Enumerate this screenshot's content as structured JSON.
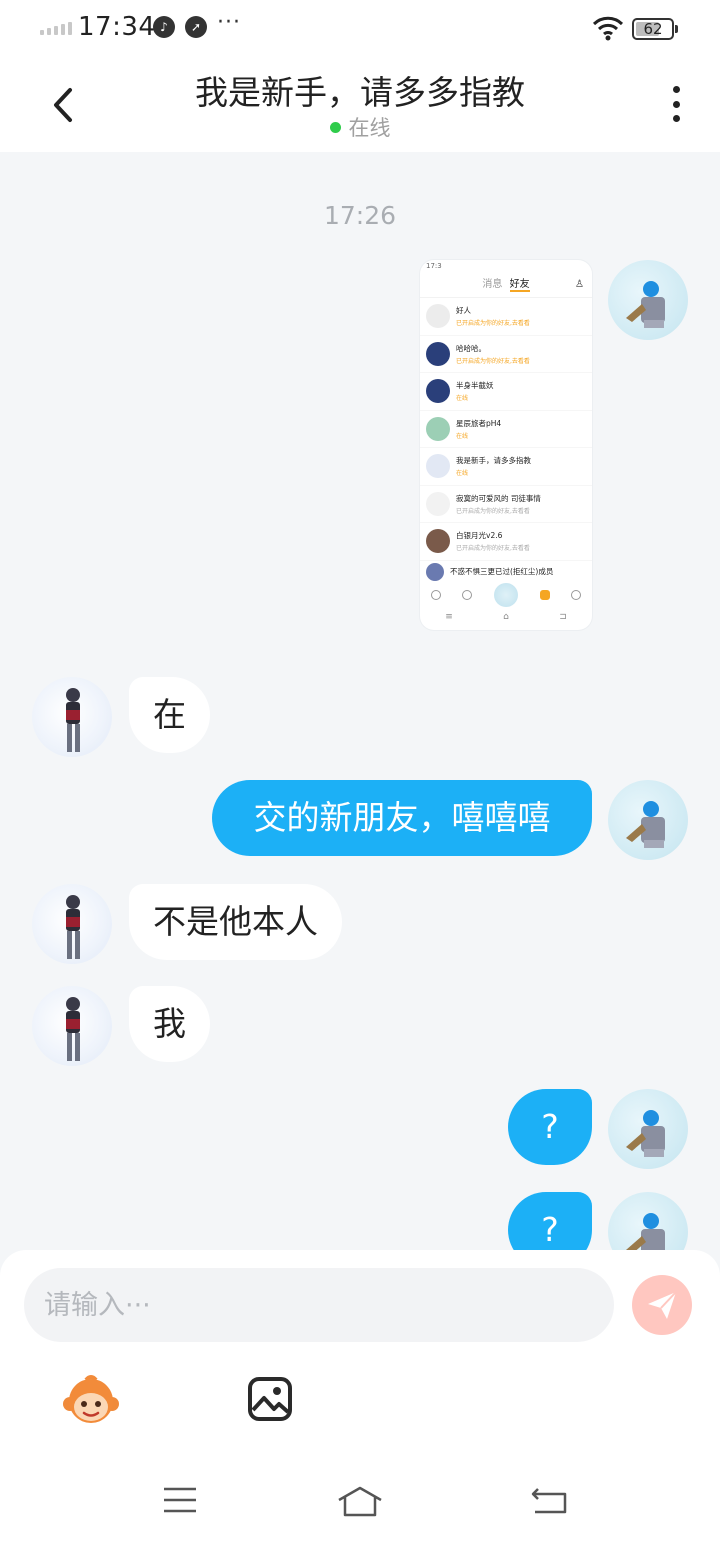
{
  "status_bar": {
    "time": "17:34",
    "more": "···",
    "battery": "62"
  },
  "header": {
    "title": "我是新手，请多多指教",
    "status": "在线"
  },
  "chat": {
    "timestamp": "17:26",
    "messages": [
      {
        "from": "me",
        "type": "image"
      },
      {
        "from": "other",
        "text": "在"
      },
      {
        "from": "me",
        "text": "交的新朋友，嘻嘻嘻"
      },
      {
        "from": "other",
        "text": "不是他本人"
      },
      {
        "from": "other",
        "text": "我"
      },
      {
        "from": "me",
        "text": "?"
      },
      {
        "from": "me",
        "text": "?"
      }
    ]
  },
  "screenshot": {
    "tab_inactive": "消息",
    "tab_active": "好友",
    "contacts": [
      {
        "name": "好人",
        "sub": "已开启成为你的好友,去看看",
        "color": "#e8e8e8"
      },
      {
        "name": "哈哈哈。",
        "sub": "已开启成为你的好友,去看看",
        "color": "#2a3f7a"
      },
      {
        "name": "半身半截妖",
        "sub": "在线",
        "color": "#2a3f7a"
      },
      {
        "name": "星辰旅者pH4",
        "sub": "在线",
        "color": "#9ccfb5"
      },
      {
        "name": "我是新手，请多多指教",
        "sub": "在线",
        "color": "#e2e8f4"
      },
      {
        "name": "寂寞的可爱风的 司徒事情",
        "sub": "已开启成为你的好友,去看看",
        "color": "#f2f2f2",
        "gray": true
      },
      {
        "name": "白银月光v2.6",
        "sub": "已开启成为你的好友,去看看",
        "color": "#7a5a4a",
        "gray": true
      },
      {
        "name": "不惑不惧三更已过(拒红尘)成员",
        "sub": "",
        "color": "#6a7ab0"
      }
    ],
    "sys_buttons": [
      "≡",
      "⌂",
      "⊐"
    ]
  },
  "input": {
    "placeholder": "请输入···"
  },
  "icons": {
    "back": "chevron-left-icon",
    "more": "more-vertical-icon",
    "send": "send-icon",
    "emoji": "emoji-monkey-icon",
    "image": "image-icon",
    "menu": "menu-icon",
    "home": "home-icon",
    "back_nav": "back-nav-icon"
  },
  "colors": {
    "accent": "#1cb0f6",
    "online": "#2fcc4b",
    "send_disabled": "#ffc7c0",
    "background": "#f4f6f8"
  }
}
